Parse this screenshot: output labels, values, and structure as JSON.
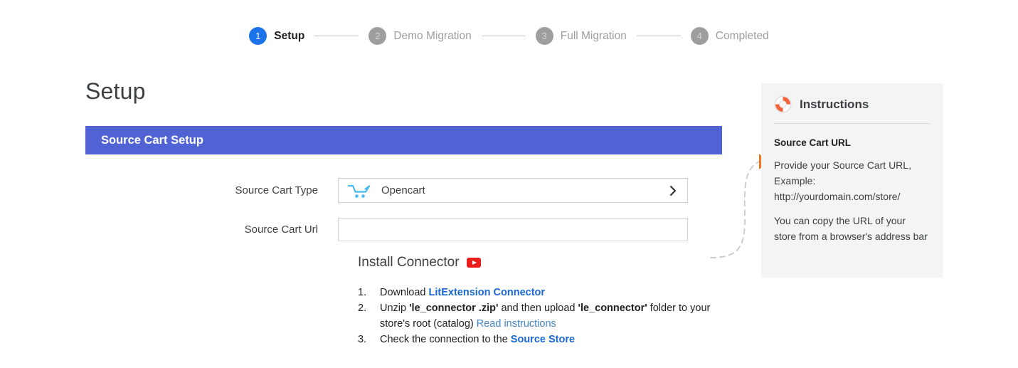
{
  "stepper": {
    "steps": [
      {
        "num": "1",
        "label": "Setup",
        "state": "done"
      },
      {
        "num": "2",
        "label": "Demo Migration",
        "state": "todo"
      },
      {
        "num": "3",
        "label": "Full Migration",
        "state": "todo"
      },
      {
        "num": "4",
        "label": "Completed",
        "state": "todo"
      }
    ]
  },
  "page": {
    "title": "Setup"
  },
  "card": {
    "header": "Source Cart Setup",
    "header_color": "#5162d4"
  },
  "form": {
    "cart_type": {
      "label": "Source Cart Type",
      "value": "Opencart",
      "icon": "shopping-cart-icon",
      "chevron": "chevron-right-icon"
    },
    "cart_url": {
      "label": "Source Cart Url",
      "value": "",
      "placeholder": ""
    }
  },
  "connector": {
    "title": "Install Connector",
    "video_icon": "youtube-icon",
    "steps": [
      {
        "num": "1.",
        "parts": [
          {
            "text": "Download ",
            "style": "plain"
          },
          {
            "text": "LitExtension Connector",
            "style": "link"
          }
        ]
      },
      {
        "num": "2.",
        "parts": [
          {
            "text": "Unzip ",
            "style": "plain"
          },
          {
            "text": "'le_connector .zip'",
            "style": "bold"
          },
          {
            "text": " and then upload ",
            "style": "plain"
          },
          {
            "text": "'le_connector'",
            "style": "bold"
          },
          {
            "text": " folder to your store's root (catalog) ",
            "style": "plain"
          },
          {
            "text": "Read instructions",
            "style": "link-plain"
          }
        ]
      },
      {
        "num": "3.",
        "parts": [
          {
            "text": "Check the connection to the ",
            "style": "plain"
          },
          {
            "text": "Source Store",
            "style": "link"
          }
        ]
      }
    ]
  },
  "instructions": {
    "icon": "lifebuoy-icon",
    "title": "Instructions",
    "subtitle": "Source Cart URL",
    "paragraph1": "Provide your Source Cart URL, Example: http://yourdomain.com/store/",
    "paragraph2": "You can copy the URL of your store from a browser's address bar",
    "pointer_color": "#f07820",
    "background": "#f4f4f4"
  }
}
